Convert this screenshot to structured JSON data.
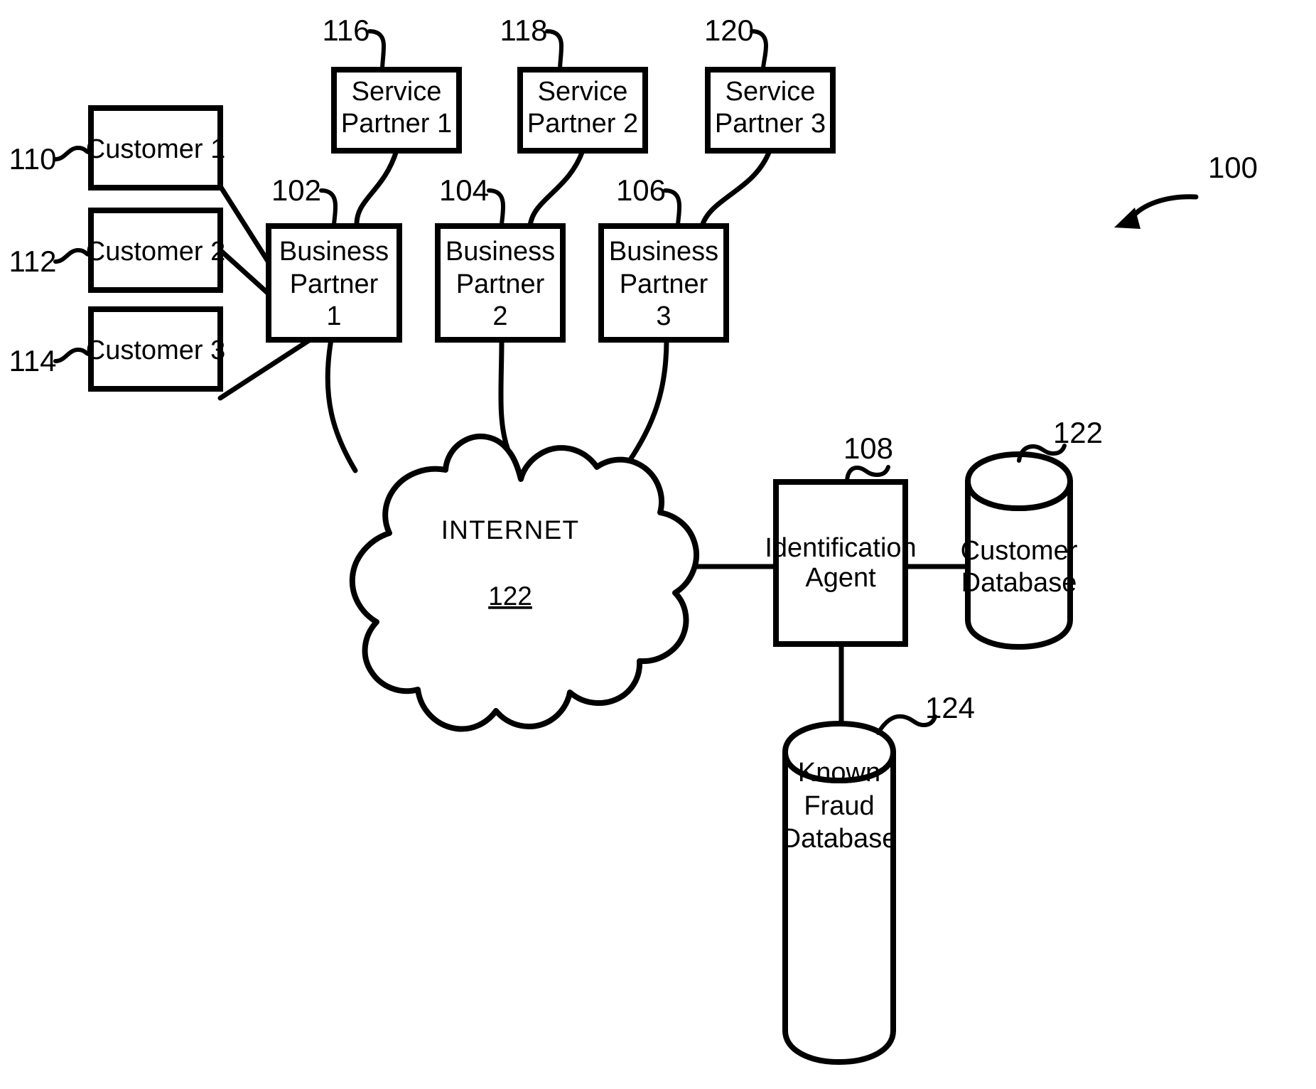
{
  "figure": {
    "figure_ref": "100",
    "customers": [
      {
        "id": "customer-1",
        "label": "Customer 1",
        "ref": "110"
      },
      {
        "id": "customer-2",
        "label": "Customer 2",
        "ref": "112"
      },
      {
        "id": "customer-3",
        "label": "Customer 3",
        "ref": "114"
      }
    ],
    "business_partners": [
      {
        "id": "business-partner-1",
        "line1": "Business",
        "line2": "Partner",
        "line3": "1",
        "ref": "102"
      },
      {
        "id": "business-partner-2",
        "line1": "Business",
        "line2": "Partner",
        "line3": "2",
        "ref": "104"
      },
      {
        "id": "business-partner-3",
        "line1": "Business",
        "line2": "Partner",
        "line3": "3",
        "ref": "106"
      }
    ],
    "service_partners": [
      {
        "id": "service-partner-1",
        "line1": "Service",
        "line2": "Partner 1",
        "ref": "116"
      },
      {
        "id": "service-partner-2",
        "line1": "Service",
        "line2": "Partner 2",
        "ref": "118"
      },
      {
        "id": "service-partner-3",
        "line1": "Service",
        "line2": "Partner 3",
        "ref": "120"
      }
    ],
    "network": {
      "id": "internet-cloud",
      "label": "INTERNET",
      "ref": "122"
    },
    "identification_agent": {
      "id": "identification-agent",
      "line1": "Identification",
      "line2": "Agent",
      "ref": "108"
    },
    "customer_database": {
      "id": "customer-database",
      "line1": "Customer",
      "line2": "Database",
      "ref": "122"
    },
    "fraud_database": {
      "id": "known-fraud-database",
      "line1": "Known",
      "line2": "Fraud",
      "line3": "Database",
      "ref": "124"
    },
    "colors": {
      "ink": "#000000",
      "paper": "#ffffff"
    }
  }
}
